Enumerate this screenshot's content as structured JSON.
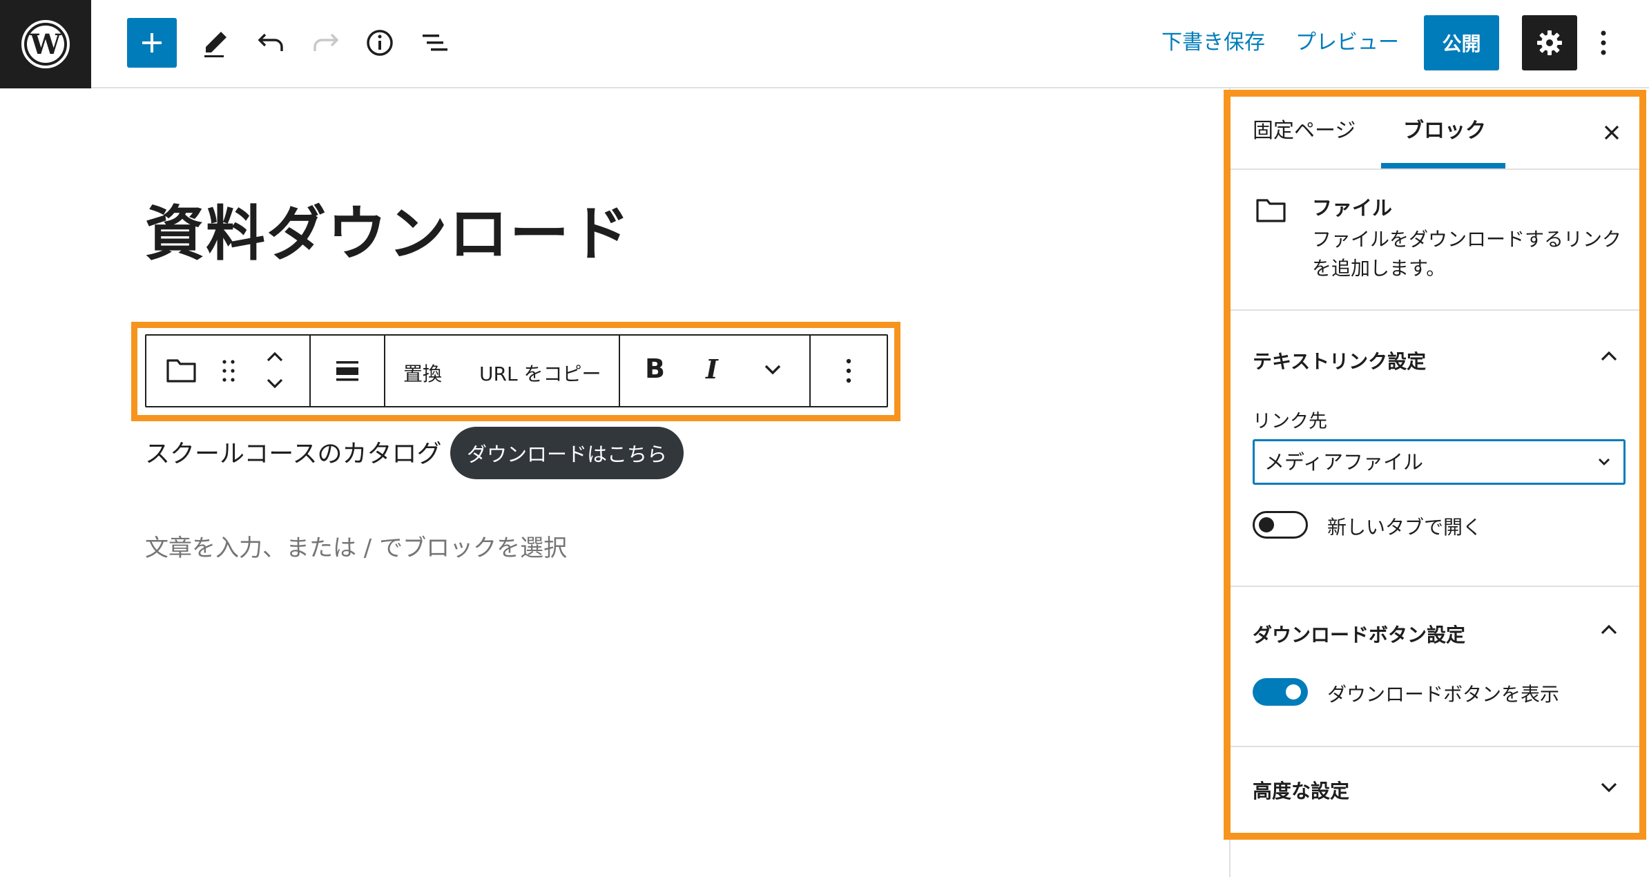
{
  "topbar": {
    "draft_save": "下書き保存",
    "preview": "プレビュー",
    "publish": "公開"
  },
  "editor": {
    "title": "資料ダウンロード",
    "toolbar": {
      "replace": "置換",
      "copy_url": "URL をコピー",
      "bold": "B",
      "italic": "I"
    },
    "file_name": "スクールコースのカタログ",
    "download_button": "ダウンロードはこちら",
    "placeholder": "文章を入力、または / でブロックを選択"
  },
  "sidebar": {
    "tabs": [
      {
        "label": "固定ページ",
        "active": false
      },
      {
        "label": "ブロック",
        "active": true
      }
    ],
    "block_card": {
      "icon": "folder-icon",
      "title": "ファイル",
      "description": "ファイルをダウンロードするリンクを追加します。"
    },
    "text_link_panel": {
      "title": "テキストリンク設定",
      "link_to_label": "リンク先",
      "link_to_value": "メディアファイル",
      "new_tab_label": "新しいタブで開く",
      "new_tab_on": false
    },
    "download_button_panel": {
      "title": "ダウンロードボタン設定",
      "show_button_label": "ダウンロードボタンを表示",
      "show_button_on": true
    },
    "advanced_panel": {
      "title": "高度な設定"
    }
  },
  "colors": {
    "accent": "#007cba",
    "highlight": "#f7941d",
    "dark": "#1e1e1e",
    "pill": "#32373c"
  }
}
